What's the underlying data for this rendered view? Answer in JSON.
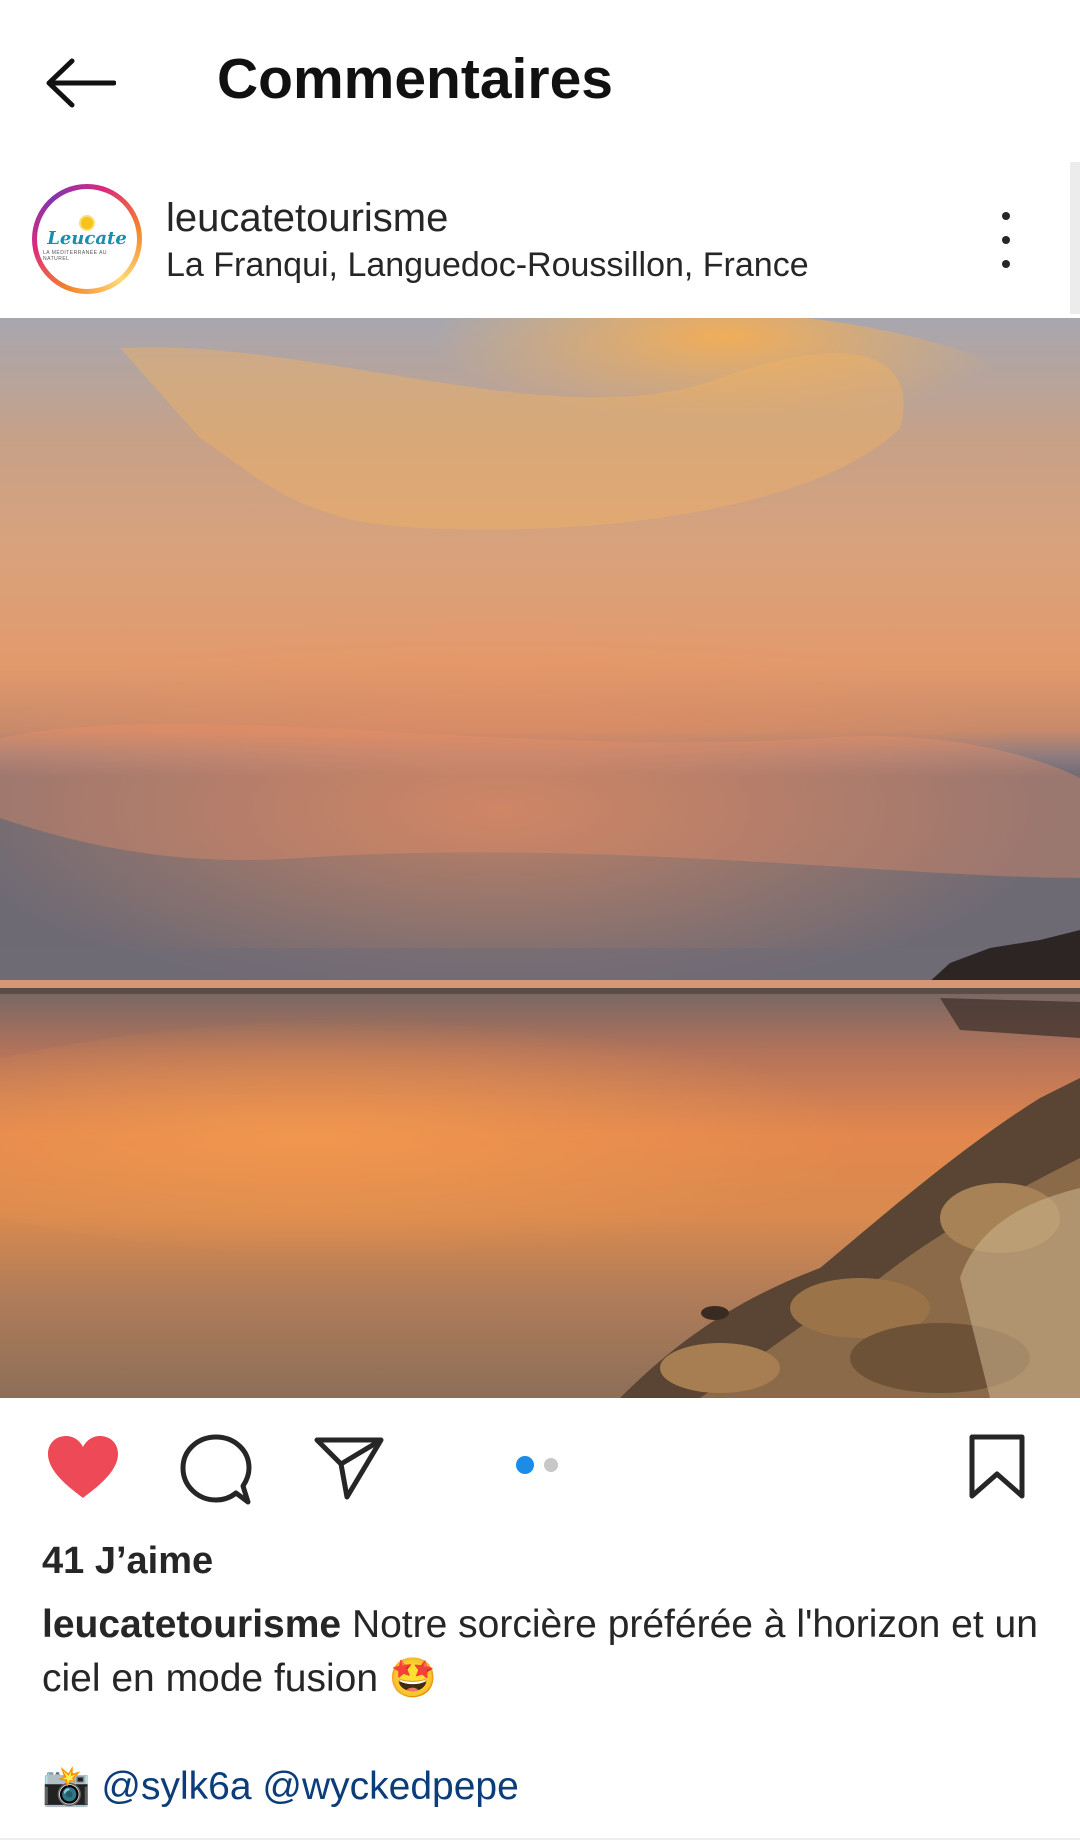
{
  "header": {
    "title": "Commentaires",
    "back_icon": "arrow-left-icon"
  },
  "post": {
    "username": "leucatetourisme",
    "location": "La Franqui, Languedoc-Roussillon, France",
    "avatar_logo_text": "Leucate",
    "avatar_logo_subtext": "LA MÉDITERRANÉE AU NATUREL",
    "photo_alt": "sunset-lagoon-photo",
    "carousel": {
      "count": 2,
      "active": 1
    },
    "likes_label": "41 J’aime",
    "caption_user": "leucatetourisme",
    "caption_text": " Notre sorcière préférée à l'horizon et un ciel en mode fusion 🤩",
    "credits_emoji": "📸",
    "mention_1": "@sylk6a",
    "mention_2": "@wyckedpepe"
  },
  "colors": {
    "like_red": "#ed4956",
    "dot_active": "#1c8ce8",
    "dot_inactive": "#c7c7c7",
    "mention_blue": "#0b3d7a"
  }
}
